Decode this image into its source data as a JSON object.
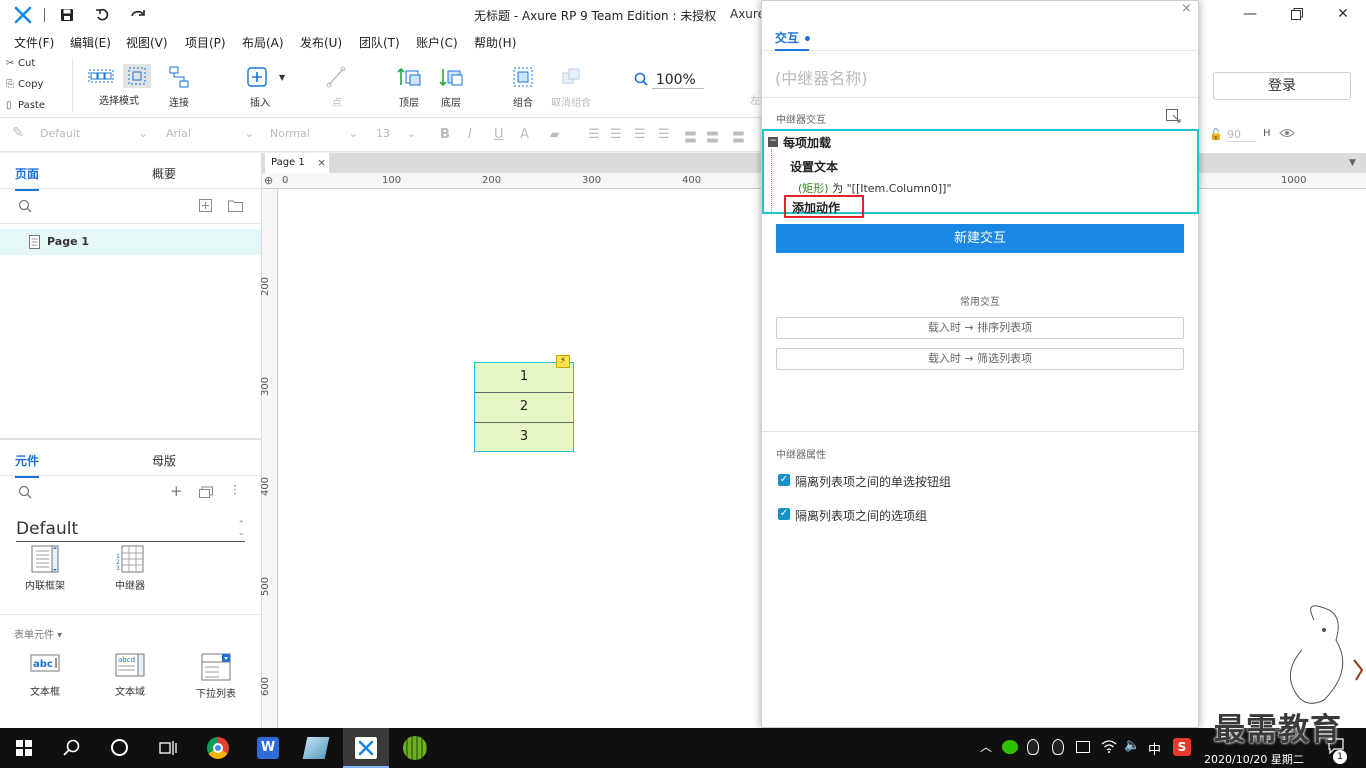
{
  "window": {
    "title": "无标题 - Axure RP 9 Team Edition : 未授权",
    "title_partial": "Axure",
    "login_label": "登录"
  },
  "menu": [
    "文件(F)",
    "编辑(E)",
    "视图(V)",
    "项目(P)",
    "布局(A)",
    "发布(U)",
    "团队(T)",
    "账户(C)",
    "帮助(H)"
  ],
  "clipboard": {
    "cut": "Cut",
    "copy": "Copy",
    "paste": "Paste"
  },
  "toolbar": {
    "select_mode": "选择模式",
    "connect": "连接",
    "insert": "插入",
    "point": "点",
    "front": "顶层",
    "back": "底层",
    "group": "组合",
    "ungroup": "取消组合",
    "zoom": "100%",
    "left_partial": "左"
  },
  "stylebar": {
    "style": "Default",
    "font": "Arial",
    "weight": "Normal",
    "size": "13",
    "height_value": "90",
    "height_label": "H"
  },
  "left_panel": {
    "tab_pages": "页面",
    "tab_outline": "概要",
    "page_item": "Page 1",
    "tab_widgets": "元件",
    "tab_masters": "母版",
    "library": "Default",
    "widget_inline_frame": "内联框架",
    "widget_repeater": "中继器",
    "form_section": "表单元件 ▾",
    "widget_textbox": "文本框",
    "widget_textarea": "文本域",
    "widget_dropdown": "下拉列表"
  },
  "canvas": {
    "tab": "Page 1",
    "ruler_top": [
      "0",
      "100",
      "200",
      "300",
      "400"
    ],
    "ruler_top_right": "1000",
    "ruler_left": [
      "200",
      "300",
      "400",
      "500",
      "600"
    ],
    "repeater_items": [
      "1",
      "2",
      "3"
    ]
  },
  "dialog": {
    "tab_interactions": "交互",
    "name_placeholder": "(中继器名称)",
    "section_repeater_interactions": "中继器交互",
    "event": "每项加载",
    "action": "设置文本",
    "target": "(矩形)",
    "detail": " 为 \"[[Item.Column0]]\"",
    "add_action": "添加动作",
    "new_interaction": "新建交互",
    "common_title": "常用交互",
    "common_1": "载入时 → 排序列表项",
    "common_2": "载入时 → 筛选列表项",
    "props_title": "中继器属性",
    "prop_1": "隔离列表项之间的单选按钮组",
    "prop_2": "隔离列表项之间的选项组"
  },
  "taskbar": {
    "ime": "中",
    "datetime": "2020/10/20 星期二",
    "watermark": "最需教育",
    "badge": "1"
  },
  "colors": {
    "accent": "#1a88e4",
    "tab_blue": "#1a73d9",
    "teal_border": "#23c3d1",
    "repeater_fill": "#e6f6c4",
    "highlight_red": "#e0262b",
    "target_green": "#2a8a1e"
  }
}
